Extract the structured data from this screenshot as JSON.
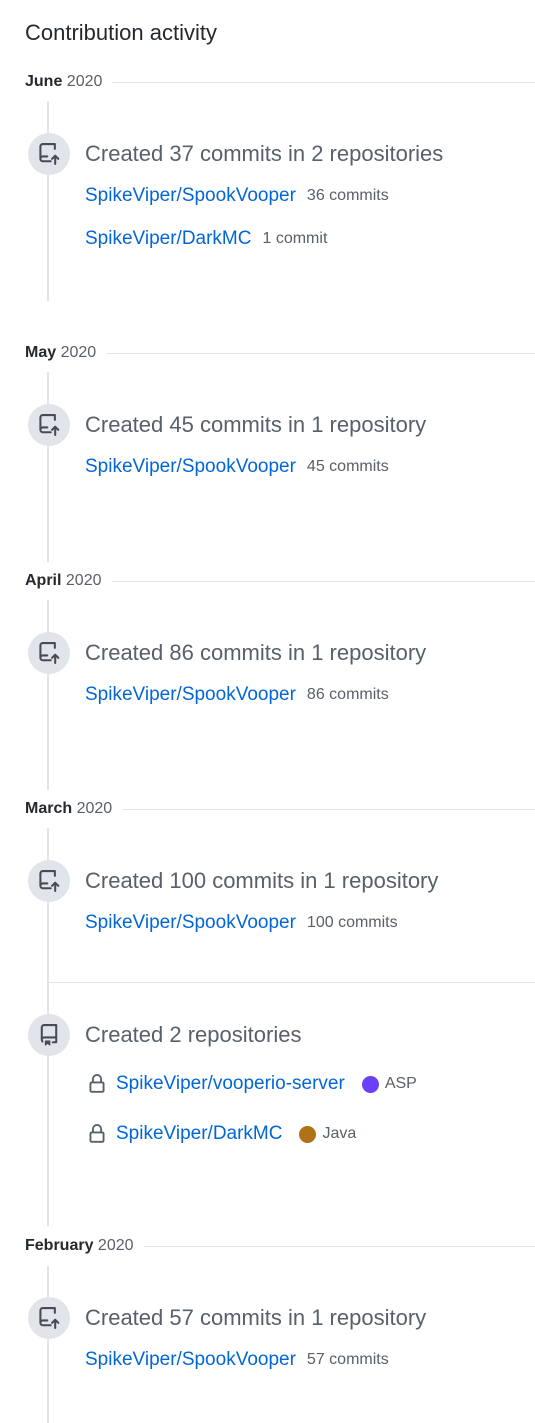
{
  "header": {
    "title": "Contribution activity"
  },
  "months": [
    {
      "month": "June",
      "year": "2020"
    },
    {
      "month": "May",
      "year": "2020"
    },
    {
      "month": "April",
      "year": "2020"
    },
    {
      "month": "March",
      "year": "2020"
    },
    {
      "month": "February",
      "year": "2020"
    }
  ],
  "events": {
    "june": {
      "summary": "Created 37 commits in 2 repositories",
      "repos": [
        {
          "name": "SpikeViper/SpookVooper",
          "count": "36 commits"
        },
        {
          "name": "SpikeViper/DarkMC",
          "count": "1 commit"
        }
      ]
    },
    "may": {
      "summary": "Created 45 commits in 1 repository",
      "repos": [
        {
          "name": "SpikeViper/SpookVooper",
          "count": "45 commits"
        }
      ]
    },
    "april": {
      "summary": "Created 86 commits in 1 repository",
      "repos": [
        {
          "name": "SpikeViper/SpookVooper",
          "count": "86 commits"
        }
      ]
    },
    "march_commits": {
      "summary": "Created 100 commits in 1 repository",
      "repos": [
        {
          "name": "SpikeViper/SpookVooper",
          "count": "100 commits"
        }
      ]
    },
    "march_repos": {
      "summary": "Created 2 repositories",
      "repos": [
        {
          "name": "SpikeViper/vooperio-server",
          "language": "ASP",
          "language_color": "#6a40fd"
        },
        {
          "name": "SpikeViper/DarkMC",
          "language": "Java",
          "language_color": "#b07219"
        }
      ]
    },
    "february": {
      "summary": "Created 57 commits in 1 repository",
      "repos": [
        {
          "name": "SpikeViper/SpookVooper",
          "count": "57 commits"
        }
      ]
    }
  },
  "icons": {
    "commit_event": "repo-push-icon",
    "repo_event": "repo-icon",
    "private": "lock-icon"
  }
}
